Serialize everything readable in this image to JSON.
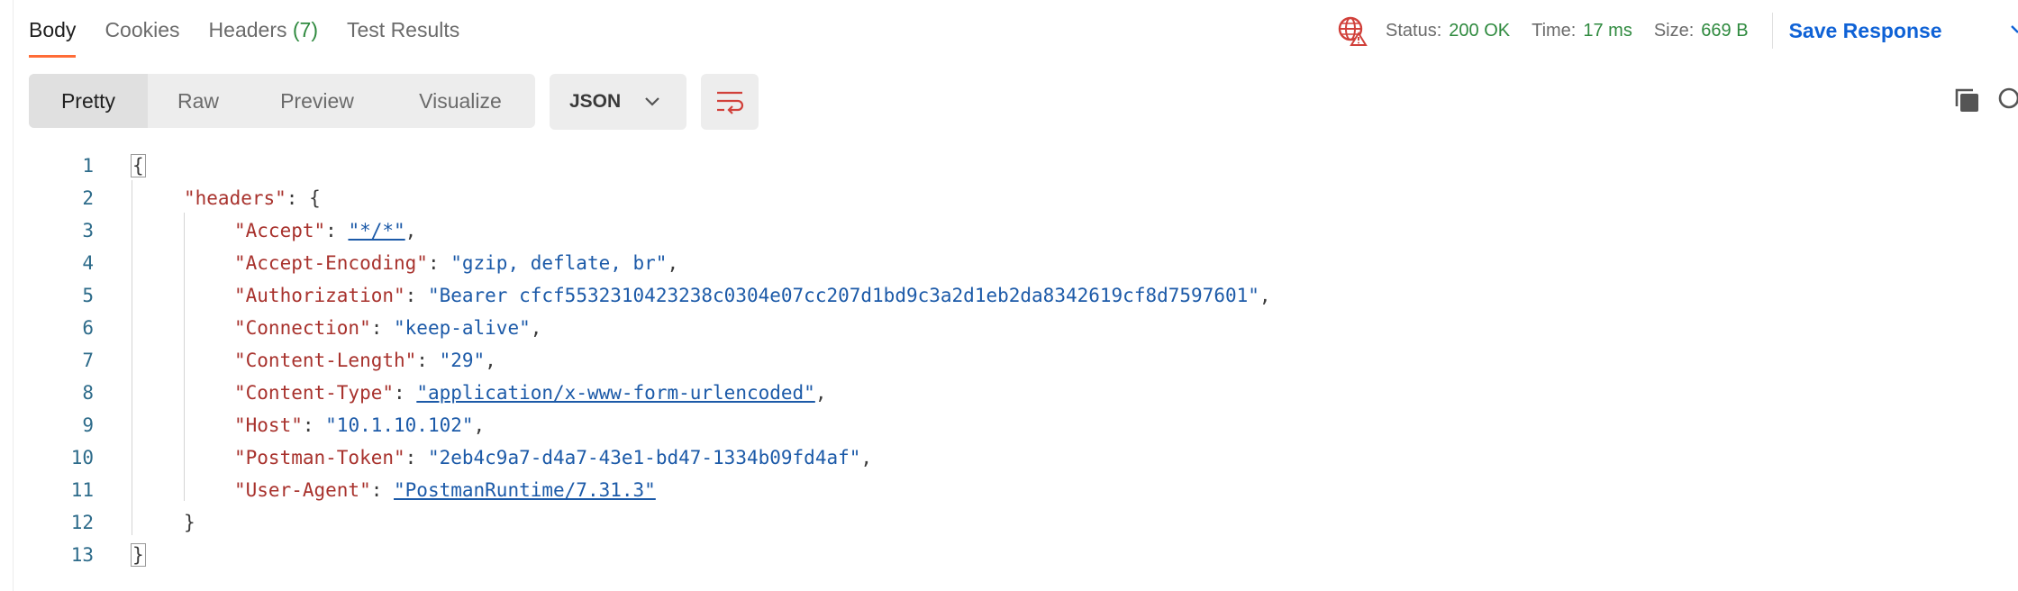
{
  "tabs": [
    {
      "label": "Body"
    },
    {
      "label": "Cookies"
    },
    {
      "label": "Headers",
      "count": "(7)"
    },
    {
      "label": "Test Results"
    }
  ],
  "status": {
    "globe_icon": "network-globe-icon",
    "status_label": "Status:",
    "status_value": "200 OK",
    "time_label": "Time:",
    "time_value": "17 ms",
    "size_label": "Size:",
    "size_value": "669 B",
    "save_label": "Save Response"
  },
  "toolbar": {
    "views": [
      "Pretty",
      "Raw",
      "Preview",
      "Visualize"
    ],
    "format": "JSON",
    "wrap_icon": "wrap-lines-icon",
    "copy_icon": "copy-icon",
    "search_icon": "search-icon"
  },
  "colors": {
    "accent": "#ff6c37",
    "success": "#2f8a3f",
    "link": "#0f62d6",
    "json_key": "#a8322d",
    "json_value": "#1c5aa8"
  },
  "code": {
    "line_numbers": [
      "1",
      "2",
      "3",
      "4",
      "5",
      "6",
      "7",
      "8",
      "9",
      "10",
      "11",
      "12",
      "13"
    ],
    "open_brace": "{",
    "close_brace": "}",
    "headers_key": "\"headers\"",
    "headers_open": ": {",
    "headers_close": "}",
    "entries": [
      {
        "key": "\"Accept\"",
        "value": "\"*/*\""
      },
      {
        "key": "\"Accept-Encoding\"",
        "value": "\"gzip, deflate, br\""
      },
      {
        "key": "\"Authorization\"",
        "value": "\"Bearer cfcf5532310423238c0304e07cc207d1bd9c3a2d1eb2da8342619cf8d7597601\""
      },
      {
        "key": "\"Connection\"",
        "value": "\"keep-alive\""
      },
      {
        "key": "\"Content-Length\"",
        "value": "\"29\""
      },
      {
        "key": "\"Content-Type\"",
        "value": "\"application/x-www-form-urlencoded\""
      },
      {
        "key": "\"Host\"",
        "value": "\"10.1.10.102\""
      },
      {
        "key": "\"Postman-Token\"",
        "value": "\"2eb4c9a7-d4a7-43e1-bd47-1334b09fd4af\""
      },
      {
        "key": "\"User-Agent\"",
        "value": "\"PostmanRuntime/7.31.3\""
      }
    ]
  }
}
